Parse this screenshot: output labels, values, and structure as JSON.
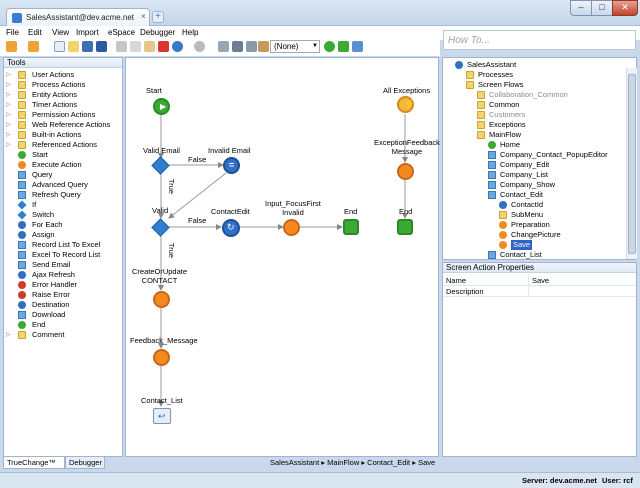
{
  "window": {
    "tab_title": "SalesAssistant@dev.acme.net",
    "tab_close": "×",
    "new_tab": "+",
    "min": "–",
    "max": "□",
    "close": "✕"
  },
  "menu": [
    "File",
    "Edit",
    "View",
    "Import",
    "eSpace",
    "Debugger",
    "Help"
  ],
  "search": {
    "placeholder": "How To..."
  },
  "toolbar": {
    "env_value": "(None)"
  },
  "left_panel": {
    "title": "Tools",
    "items": [
      {
        "label": "User Actions",
        "icon": "folder"
      },
      {
        "label": "Process Actions",
        "icon": "folder"
      },
      {
        "label": "Entity Actions",
        "icon": "folder"
      },
      {
        "label": "Timer Actions",
        "icon": "folder"
      },
      {
        "label": "Permission Actions",
        "icon": "folder"
      },
      {
        "label": "Web Reference Actions",
        "icon": "folder"
      },
      {
        "label": "Built-in Actions",
        "icon": "folder"
      },
      {
        "label": "Referenced Actions",
        "icon": "folder"
      },
      {
        "label": "Start",
        "icon": "greenc"
      },
      {
        "label": "Execute Action",
        "icon": "orangec"
      },
      {
        "label": "Query",
        "icon": "square"
      },
      {
        "label": "Advanced Query",
        "icon": "square"
      },
      {
        "label": "Refresh Query",
        "icon": "square"
      },
      {
        "label": "If",
        "icon": "diam"
      },
      {
        "label": "Switch",
        "icon": "diam"
      },
      {
        "label": "For Each",
        "icon": "bluec"
      },
      {
        "label": "Assign",
        "icon": "bluec"
      },
      {
        "label": "Record List To Excel",
        "icon": "square"
      },
      {
        "label": "Excel To Record List",
        "icon": "square"
      },
      {
        "label": "Send Email",
        "icon": "square"
      },
      {
        "label": "Ajax Refresh",
        "icon": "bluec"
      },
      {
        "label": "Error Handler",
        "icon": "redc"
      },
      {
        "label": "Raise Error",
        "icon": "redc"
      },
      {
        "label": "Destination",
        "icon": "bluec"
      },
      {
        "label": "Download",
        "icon": "square"
      },
      {
        "label": "End",
        "icon": "greenc"
      },
      {
        "label": "Comment",
        "icon": "folder"
      }
    ],
    "tabs": [
      "TrueChange™",
      "Debugger"
    ]
  },
  "flow": {
    "nodes": {
      "start": "Start",
      "valid_email": "Valid Email",
      "invalid_email": "Invalid Email",
      "valid": "Valid",
      "contact_edit": "ContactEdit",
      "input_focus": "Input_FocusFirst\nInvalid",
      "end1": "End",
      "create_update": "CreateOrUpdate\nCONTACT",
      "feedback": "Feedback_Message",
      "contact_list": "Contact_List",
      "all_exceptions": "All Exceptions",
      "exc_feedback": "ExceptionFeedback\nMessage",
      "end2": "End"
    },
    "branch_labels": {
      "false1": "False",
      "true1": "True",
      "false2": "False",
      "true2": "True"
    }
  },
  "breadcrumb": [
    "SalesAssistant",
    "MainFlow",
    "Contact_Edit",
    "Save"
  ],
  "tree": {
    "items": [
      {
        "label": "SalesAssistant",
        "depth": 0,
        "icon": "bluec",
        "grey": false
      },
      {
        "label": "Processes",
        "depth": 1,
        "icon": "folder",
        "grey": false
      },
      {
        "label": "Screen Flows",
        "depth": 1,
        "icon": "folder",
        "grey": false
      },
      {
        "label": "Collaboration_Common",
        "depth": 2,
        "icon": "folder",
        "grey": true
      },
      {
        "label": "Common",
        "depth": 2,
        "icon": "folder",
        "grey": false
      },
      {
        "label": "Customers",
        "depth": 2,
        "icon": "folder",
        "grey": true
      },
      {
        "label": "Exceptions",
        "depth": 2,
        "icon": "folder",
        "grey": false
      },
      {
        "label": "MainFlow",
        "depth": 2,
        "icon": "folder",
        "grey": false
      },
      {
        "label": "Home",
        "depth": 3,
        "icon": "greenc",
        "grey": false
      },
      {
        "label": "Company_Contact_PopupEditor",
        "depth": 3,
        "icon": "square",
        "grey": false
      },
      {
        "label": "Company_Edit",
        "depth": 3,
        "icon": "square",
        "grey": false
      },
      {
        "label": "Company_List",
        "depth": 3,
        "icon": "square",
        "grey": false
      },
      {
        "label": "Company_Show",
        "depth": 3,
        "icon": "square",
        "grey": false
      },
      {
        "label": "Contact_Edit",
        "depth": 3,
        "icon": "square",
        "grey": false
      },
      {
        "label": "ContactId",
        "depth": 4,
        "icon": "bluec",
        "grey": false
      },
      {
        "label": "SubMenu",
        "depth": 4,
        "icon": "folder",
        "grey": false
      },
      {
        "label": "Preparation",
        "depth": 4,
        "icon": "orangec",
        "grey": false
      },
      {
        "label": "ChangePicture",
        "depth": 4,
        "icon": "orangec",
        "grey": false
      },
      {
        "label": "Save",
        "depth": 4,
        "icon": "orangec",
        "grey": false
      },
      {
        "label": "Contact_List",
        "depth": 3,
        "icon": "square",
        "grey": false
      }
    ]
  },
  "properties": {
    "title": "Screen Action Properties",
    "rows": [
      {
        "name": "Name",
        "value": "Save"
      },
      {
        "name": "Description",
        "value": ""
      }
    ]
  },
  "status": {
    "server": "Server: dev.acme.net",
    "user": "User: rcf"
  },
  "colors": {
    "accent": "#3163c5",
    "chrome": "#c9d8ea"
  }
}
